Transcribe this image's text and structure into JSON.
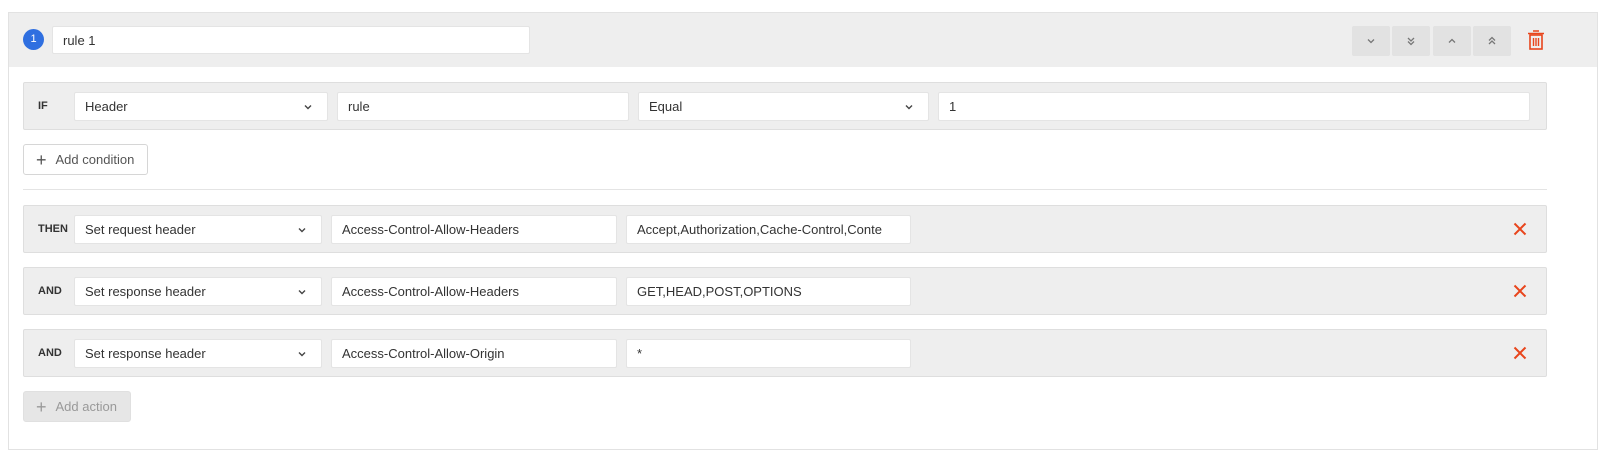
{
  "rule": {
    "number": "1",
    "name_value": "rule 1"
  },
  "colors": {
    "accent": "#2f6fe0",
    "danger": "#e8451c"
  },
  "condition": {
    "label": "IF",
    "type_value": "Header",
    "name_value": "rule",
    "operator_value": "Equal",
    "match_value": "1"
  },
  "add_condition_label": "Add condition",
  "actions": [
    {
      "label": "THEN",
      "type_value": "Set request header",
      "name_value": "Access-Control-Allow-Headers",
      "value": "Accept,Authorization,Cache-Control,Conte"
    },
    {
      "label": "AND",
      "type_value": "Set response header",
      "name_value": "Access-Control-Allow-Headers",
      "value": "GET,HEAD,POST,OPTIONS"
    },
    {
      "label": "AND",
      "type_value": "Set response header",
      "name_value": "Access-Control-Allow-Origin",
      "value": "*"
    }
  ],
  "add_action_label": "Add action",
  "icons": [
    "chevron-down-icon",
    "double-chevron-down-icon",
    "chevron-up-icon",
    "double-chevron-up-icon",
    "trash-icon",
    "close-icon",
    "plus-icon"
  ]
}
